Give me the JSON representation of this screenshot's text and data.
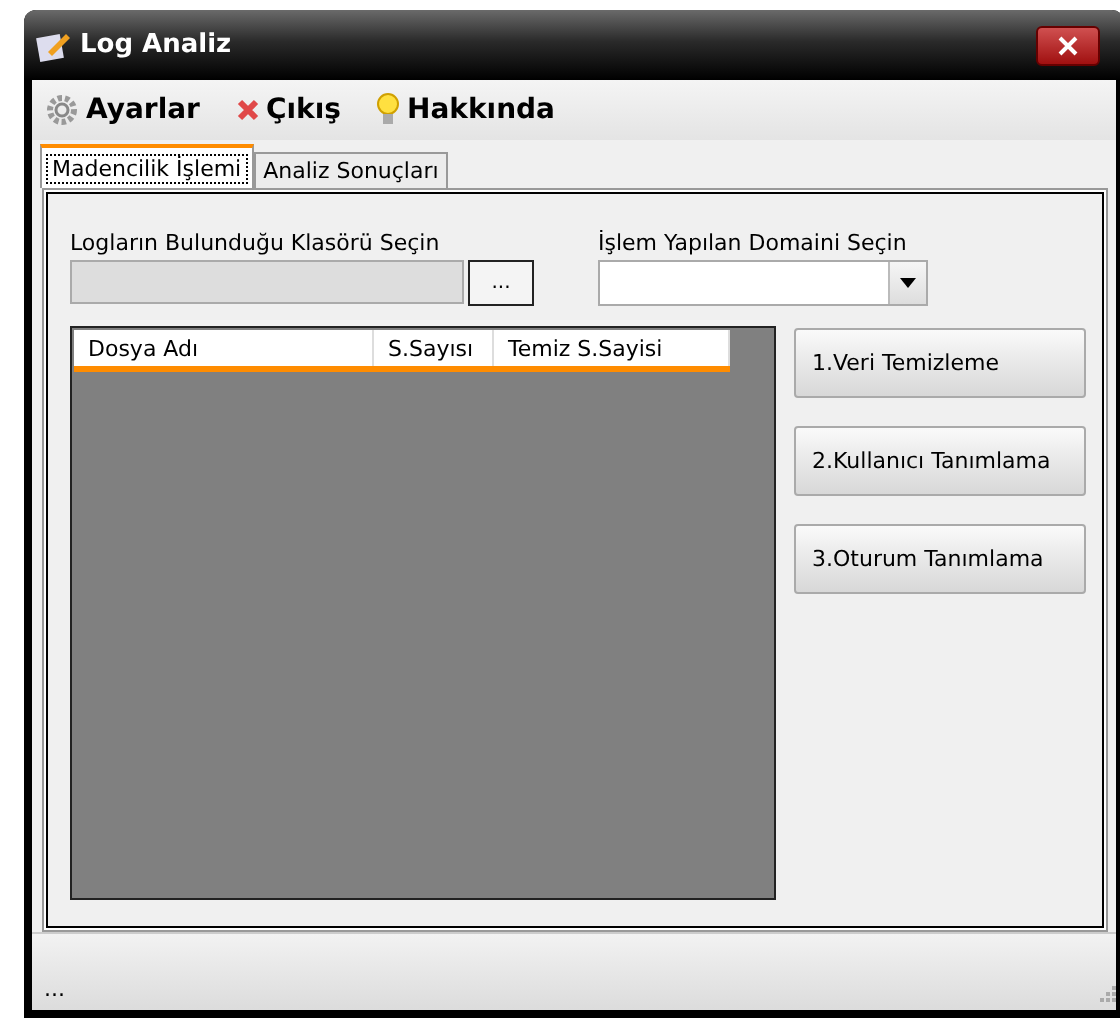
{
  "window": {
    "title": "Log Analiz"
  },
  "menu": [
    {
      "label": "Ayarlar",
      "kind": "gear"
    },
    {
      "label": "Çıkış",
      "kind": "cross"
    },
    {
      "label": "Hakkında",
      "kind": "bulb"
    }
  ],
  "tabs": [
    {
      "label": "Madencilik İşlemi",
      "selected": true
    },
    {
      "label": "Analiz Sonuçları",
      "selected": false
    }
  ],
  "folder": {
    "label": "Logların Bulunduğu Klasörü Seçin",
    "browse_button": "..."
  },
  "domain": {
    "label": "İşlem Yapılan Domaini Seçin"
  },
  "table": {
    "columns": [
      "Dosya Adı",
      "S.Sayısı",
      "Temiz S.Sayisi"
    ]
  },
  "actions": [
    "1.Veri Temizleme",
    "2.Kullanıcı Tanımlama",
    "3.Oturum Tanımlama"
  ],
  "status_bar": {
    "text": "..."
  }
}
